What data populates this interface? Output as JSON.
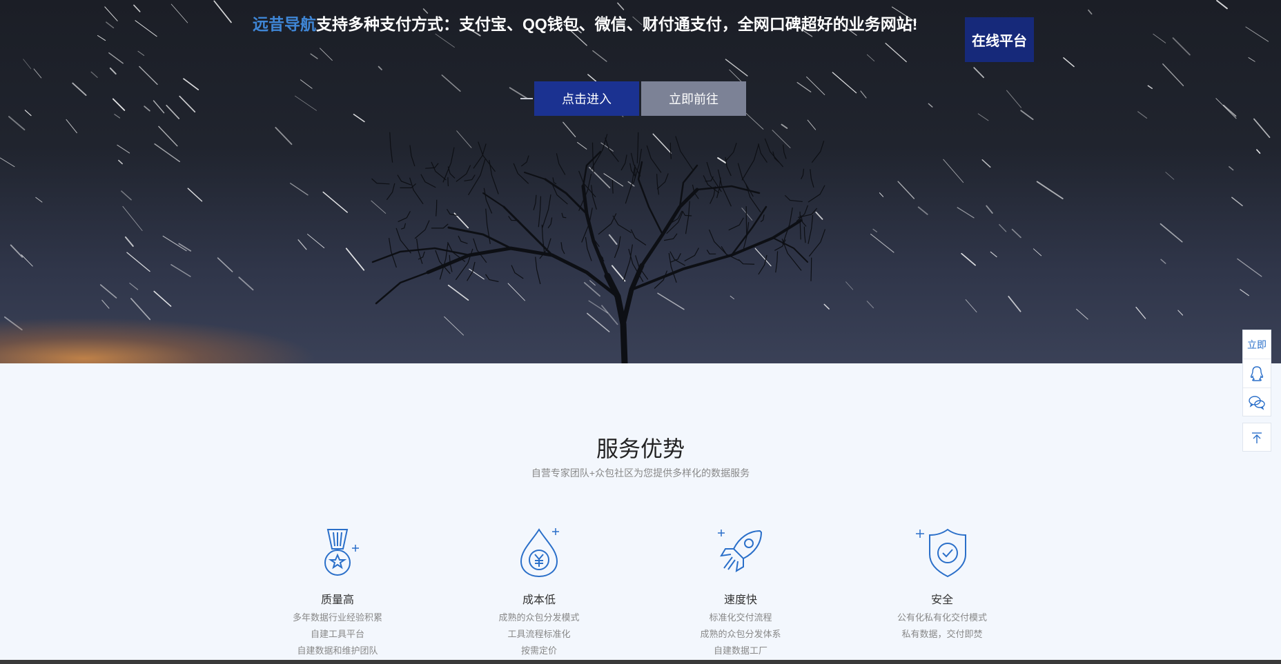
{
  "hero": {
    "brand": "远昔导航",
    "headline": "支持多种支付方式：支付宝、QQ钱包、微信、财付通支付，全网口碑超好的业务网站!",
    "platform_button": "在线平台",
    "enter_button": "点击进入",
    "go_button": "立即前往"
  },
  "services": {
    "title": "服务优势",
    "subtitle": "自营专家团队+众包社区为您提供多样化的数据服务",
    "items": [
      {
        "icon": "medal-icon",
        "name": "质量高",
        "lines": [
          "多年数据行业经验积累",
          "自建工具平台",
          "自建数据和维护团队"
        ]
      },
      {
        "icon": "yuan-drop-icon",
        "name": "成本低",
        "lines": [
          "成熟的众包分发模式",
          "工具流程标准化",
          "按需定价"
        ]
      },
      {
        "icon": "rocket-icon",
        "name": "速度快",
        "lines": [
          "标准化交付流程",
          "成熟的众包分发体系",
          "自建数据工厂"
        ]
      },
      {
        "icon": "shield-check-icon",
        "name": "安全",
        "lines": [
          "公有化私有化交付模式",
          "私有数据，交付即焚",
          ""
        ]
      }
    ]
  },
  "sidebar": {
    "now_label": "立即",
    "qq_icon": "qq-icon",
    "wechat_icon": "wechat-icon",
    "top_icon": "back-to-top-icon"
  },
  "colors": {
    "accent": "#1b3291",
    "brand_text": "#3f86d6",
    "icon_blue": "#2a6fc9"
  }
}
